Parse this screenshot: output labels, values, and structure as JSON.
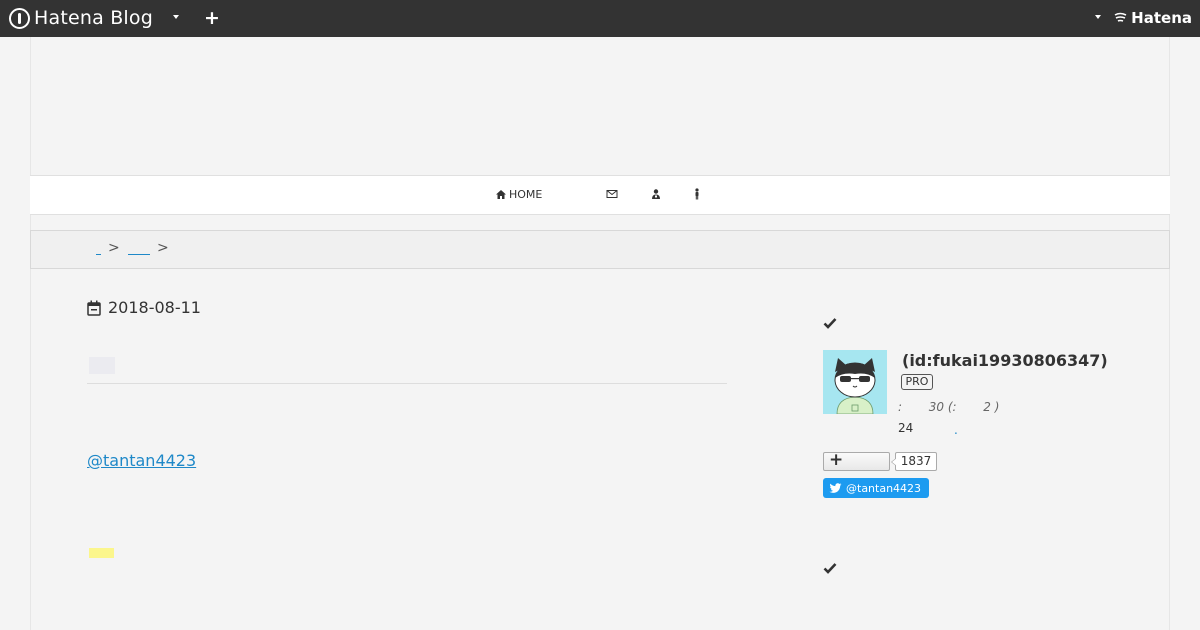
{
  "header": {
    "brand_name": "Hatena Blog",
    "hatena_label": "Hatena"
  },
  "nav": {
    "home_label": "HOME",
    "icons": [
      "home-icon",
      "envelope-icon",
      "user-icon",
      "person-icon"
    ]
  },
  "breadcrumb": {
    "separator": ">"
  },
  "entry": {
    "date": "2018-08-11",
    "handle_link": "@tantan4423"
  },
  "sidebar": {
    "profile_id": "(id:fukai19930806347)",
    "pro_badge": "PRO",
    "meta_line": ":       30 (:       2 )",
    "count_line": "24",
    "count_dot": ".",
    "follow_count": "1837",
    "twitter_label": "@tantan4423"
  },
  "colors": {
    "header_bg": "#333333",
    "link": "#1e88c8",
    "twitter": "#1d9bf0",
    "highlight": "#fbf68c",
    "avatar_bg": "#a6e6f0"
  }
}
